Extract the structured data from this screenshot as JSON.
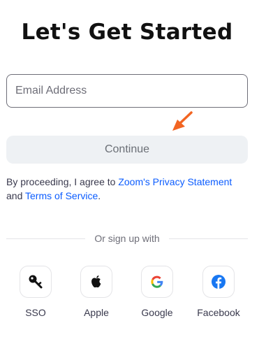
{
  "heading": "Let's Get Started",
  "email": {
    "placeholder": "Email Address",
    "value": ""
  },
  "continue_label": "Continue",
  "legal": {
    "prefix": "By proceeding, I agree to ",
    "privacy_link": "Zoom's Privacy Statement",
    "middle": " and ",
    "terms_link": "Terms of Service",
    "suffix": "."
  },
  "divider_text": "Or sign up with",
  "providers": [
    {
      "label": "SSO",
      "icon": "key-icon"
    },
    {
      "label": "Apple",
      "icon": "apple-icon"
    },
    {
      "label": "Google",
      "icon": "google-icon"
    },
    {
      "label": "Facebook",
      "icon": "facebook-icon"
    }
  ],
  "colors": {
    "link": "#0b5cff",
    "button_bg": "#eef1f4",
    "arrow": "#f26522",
    "facebook": "#1877f2"
  }
}
